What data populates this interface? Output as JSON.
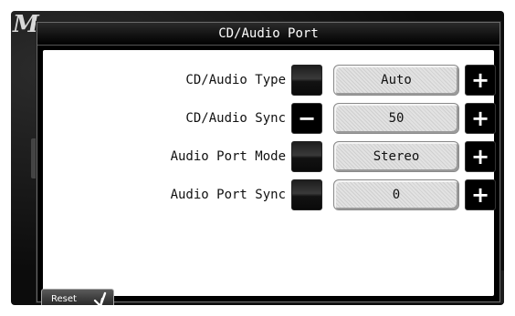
{
  "background": {
    "logo_text": "M"
  },
  "dialog": {
    "title": "CD/Audio Port",
    "rows": [
      {
        "label": "CD/Audio Type",
        "value": "Auto",
        "minus_enabled": false,
        "plus_enabled": true
      },
      {
        "label": "CD/Audio Sync",
        "value": "50",
        "minus_enabled": true,
        "plus_enabled": true
      },
      {
        "label": "Audio Port Mode",
        "value": "Stereo",
        "minus_enabled": false,
        "plus_enabled": true
      },
      {
        "label": "Audio Port Sync",
        "value": "0",
        "minus_enabled": false,
        "plus_enabled": true
      }
    ],
    "minus_symbol": "−",
    "plus_symbol": "+",
    "reset_label": "Reset",
    "reset_icon": "return-arrow-icon"
  }
}
